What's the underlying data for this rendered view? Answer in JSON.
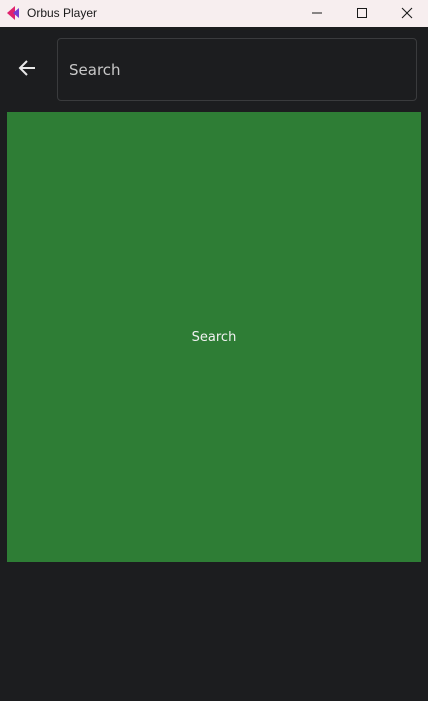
{
  "window": {
    "title": "Orbus Player",
    "icons": {
      "app": "orbus-logo-icon",
      "minimize": "minimize-icon",
      "maximize": "maximize-icon",
      "close": "close-icon"
    }
  },
  "header": {
    "back_icon": "arrow-left-icon",
    "search": {
      "placeholder": "Search",
      "value": ""
    }
  },
  "main": {
    "panel_label": "Search"
  },
  "colors": {
    "titlebar_bg": "#f7eeef",
    "app_bg": "#1c1d1f",
    "panel_bg": "#2e7d35",
    "logo_pink": "#e0226e",
    "logo_purple": "#7a3bd0"
  }
}
